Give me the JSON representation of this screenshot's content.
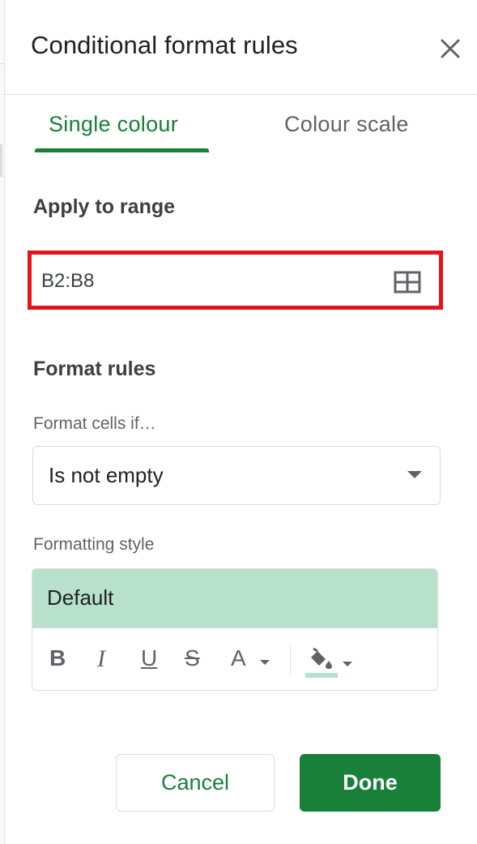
{
  "dialog": {
    "title": "Conditional format rules",
    "close_icon": "close-icon"
  },
  "tabs": [
    {
      "label": "Single colour",
      "active": true
    },
    {
      "label": "Colour scale",
      "active": false
    }
  ],
  "apply_to_range": {
    "heading": "Apply to range",
    "value": "B2:B8",
    "icon": "grid-select-icon",
    "highlight_color": "#e3141b"
  },
  "format_rules": {
    "heading": "Format rules",
    "condition_label": "Format cells if…",
    "condition_value": "Is not empty",
    "style_label": "Formatting style",
    "style_preview": "Default",
    "preview_color": "#b7e1cd",
    "toolbar": {
      "bold": "B",
      "italic": "I",
      "underline": "U",
      "strikethrough": "S",
      "text_color": "A",
      "fill_icon": "fill-color-icon"
    }
  },
  "actions": {
    "cancel": "Cancel",
    "done": "Done"
  },
  "colors": {
    "accent": "#188038"
  }
}
